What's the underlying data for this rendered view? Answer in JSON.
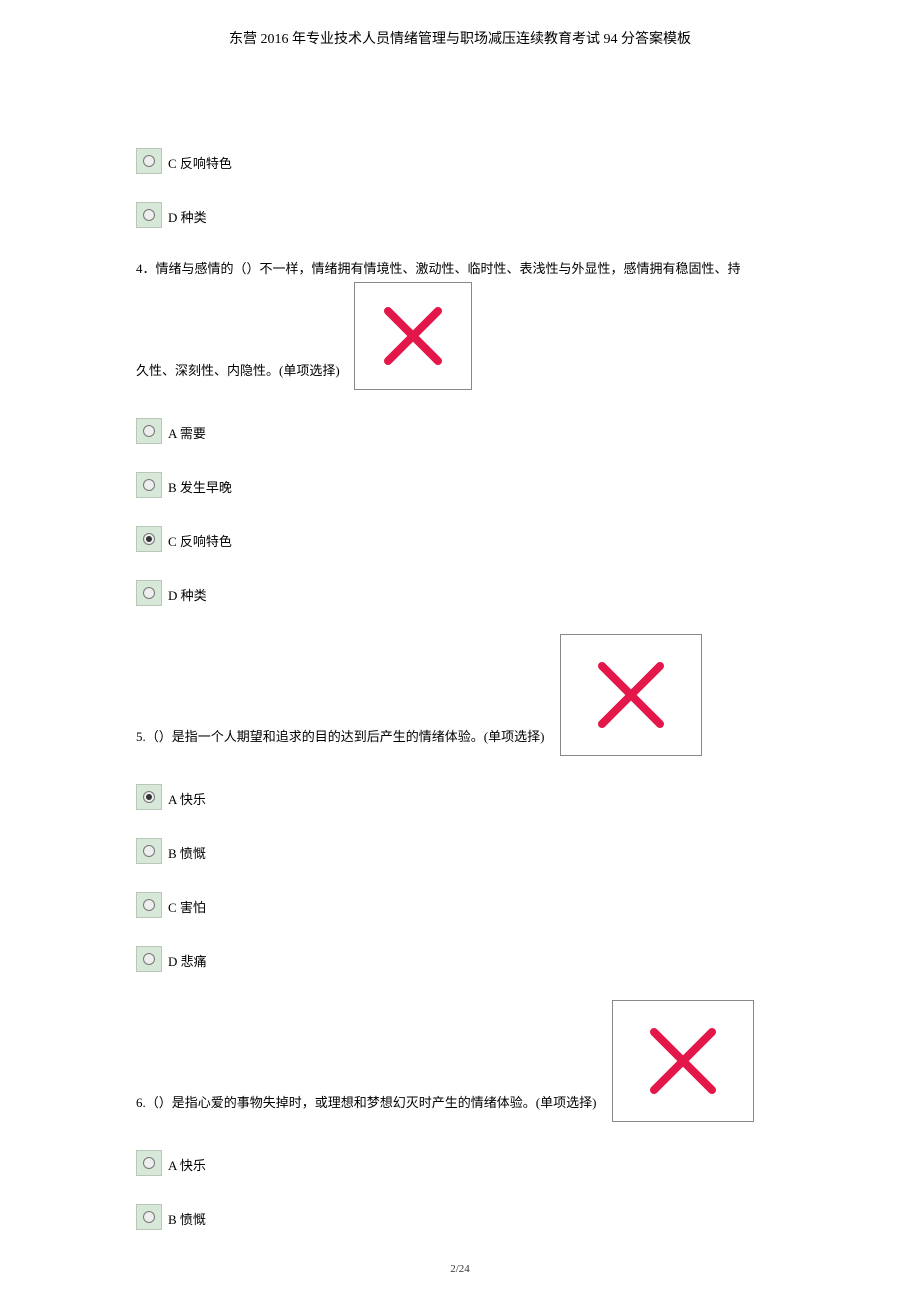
{
  "header": "东营 2016 年专业技术人员情绪管理与职场减压连续教育考试 94 分答案模板",
  "prev_options": {
    "c": "C 反响特色",
    "d": "D 种类"
  },
  "q4": {
    "line1": "4．情绪与感情的（）不一样，情绪拥有情境性、激动性、临时性、表浅性与外显性，感情拥有稳固性、持",
    "line2": "久性、深刻性、内隐性。(单项选择)",
    "opts": {
      "a": "A 需要",
      "b": "B 发生早晚",
      "c": "C 反响特色",
      "d": "D 种类"
    }
  },
  "q5": {
    "text": "5.（）是指一个人期望和追求的目的达到后产生的情绪体验。(单项选择)",
    "opts": {
      "a": "A 快乐",
      "b": "B 愤慨",
      "c": "C 害怕",
      "d": "D 悲痛"
    }
  },
  "q6": {
    "text": "6.（）是指心爱的事物失掉时，或理想和梦想幻灭时产生的情绪体验。(单项选择)",
    "opts": {
      "a": "A 快乐",
      "b": "B 愤慨"
    }
  },
  "footer": "2/24"
}
